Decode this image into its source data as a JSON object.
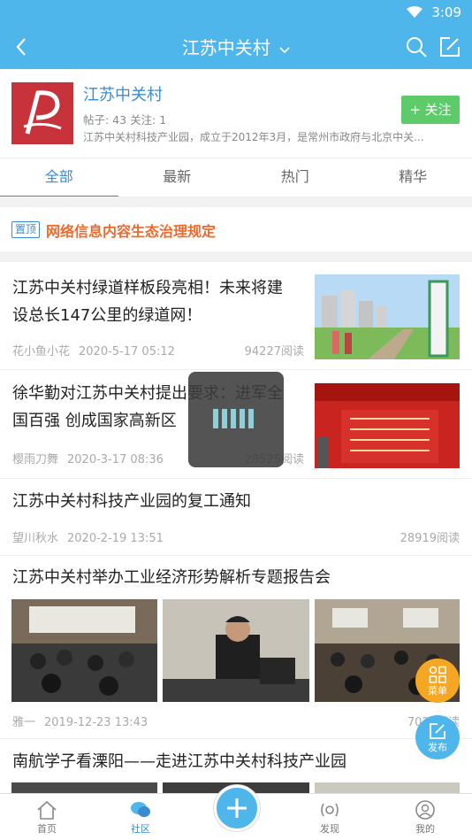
{
  "status_bar": {
    "time": "3:09"
  },
  "header": {
    "title": "江苏中关村"
  },
  "community": {
    "name": "江苏中关村",
    "stats": "帖子: 43  关注: 1",
    "description": "江苏中关村科技产业园，成立于2012年3月，是常州市政府与北京中关...",
    "follow_label": "+ 关注"
  },
  "tabs": [
    "全部",
    "最新",
    "热门",
    "精华"
  ],
  "pinned": {
    "badge": "置顶",
    "title": "网络信息内容生态治理规定"
  },
  "posts": [
    {
      "title_line1": "江苏中关村绿道样板段亮相！未来将建",
      "title_line2": "设总长147公里的绿道网！",
      "author": "花小鱼小花",
      "date": "2020-5-17 05:12",
      "reads": "94227阅读"
    },
    {
      "title_line1": "徐华勤对江苏中关村提出要求：进军全",
      "title_line2": "国百强 创成国家高新区",
      "author": "樱雨刀舞",
      "date": "2020-3-17 08:36",
      "reads": "28525阅读"
    },
    {
      "title_line1": "江苏中关村科技产业园的复工通知",
      "author": "望川秋水",
      "date": "2020-2-19 13:51",
      "reads": "28919阅读"
    },
    {
      "title_line1": "江苏中关村举办工业经济形势解析专题报告会",
      "author": "雅一",
      "date": "2019-12-23 13:43",
      "reads": "7021阅读"
    },
    {
      "title_line1": "南航学子看溧阳——走进江苏中关村科技产业园"
    }
  ],
  "fab": {
    "menu_label": "菜单",
    "publish_label": "发布"
  },
  "bottom_nav": [
    {
      "label": "首页",
      "icon": "home-icon"
    },
    {
      "label": "社区",
      "icon": "community-icon",
      "active": true
    },
    {
      "label": "发现",
      "icon": "discover-icon"
    },
    {
      "label": "我的",
      "icon": "profile-icon"
    }
  ],
  "colors": {
    "primary": "#4fb6ec",
    "accent": "#3a8ccf",
    "pinned": "#f06a2c",
    "follow": "#5ecb6b",
    "menu_fab": "#f5a623"
  }
}
